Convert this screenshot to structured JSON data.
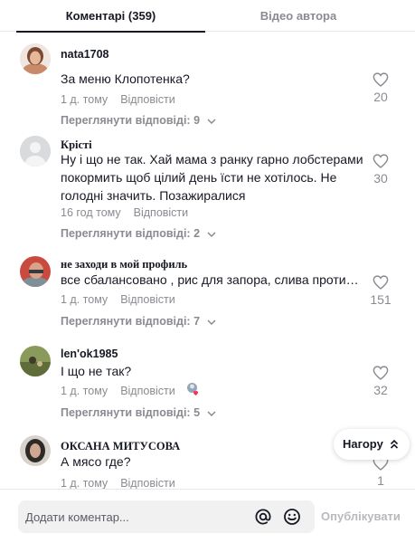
{
  "tabs": {
    "comments": "Коментарі (359)",
    "creator_videos": "Відео автора"
  },
  "comments": [
    {
      "username": "nata1708",
      "text": "За меню Клопотенка?",
      "time": "1 д. тому",
      "reply": "Відповісти",
      "view_replies": "Переглянути відповіді: 9",
      "likes": "20"
    },
    {
      "username": "Крісті",
      "text": "Ну і що не так. Хай мама з ранку гарно лобстерами покормить щоб цілий день їсти не хотілось. Не голодні значить. Позажиралися",
      "time": "16 год тому",
      "reply": "Відповісти",
      "view_replies": "Переглянути відповіді: 2",
      "likes": "30"
    },
    {
      "username": "не заходи в мой профиль",
      "text": "все сбалансовано , рис для запора, слива проти запора",
      "time": "1 д. тому",
      "reply": "Відповісти",
      "view_replies": "Переглянути відповіді: 7",
      "likes": "151"
    },
    {
      "username": "len'ok1985",
      "text": "І що не так?",
      "time": "1 д. тому",
      "reply": "Відповісти",
      "view_replies": "Переглянути відповіді: 5",
      "likes": "32"
    },
    {
      "username": "ОКСАНА МИТУСОВА",
      "text": "А мясо где?",
      "time": "1 д. тому",
      "reply": "Відповісти",
      "likes": "1"
    }
  ],
  "scroll_top": {
    "label": "Нагору"
  },
  "footer": {
    "placeholder": "Додати коментар...",
    "publish": "Опублікувати"
  },
  "colors": {
    "text": "#161823",
    "muted": "#8a8b91",
    "divider": "#e8e8ea",
    "input_bg": "#f1f1f2",
    "creator_badge": "#fe2c55"
  },
  "icons": [
    "heart-icon",
    "chevron-down-icon",
    "double-chevron-up-icon",
    "at-mention-icon",
    "emoji-icon",
    "creator-liked-icon"
  ]
}
